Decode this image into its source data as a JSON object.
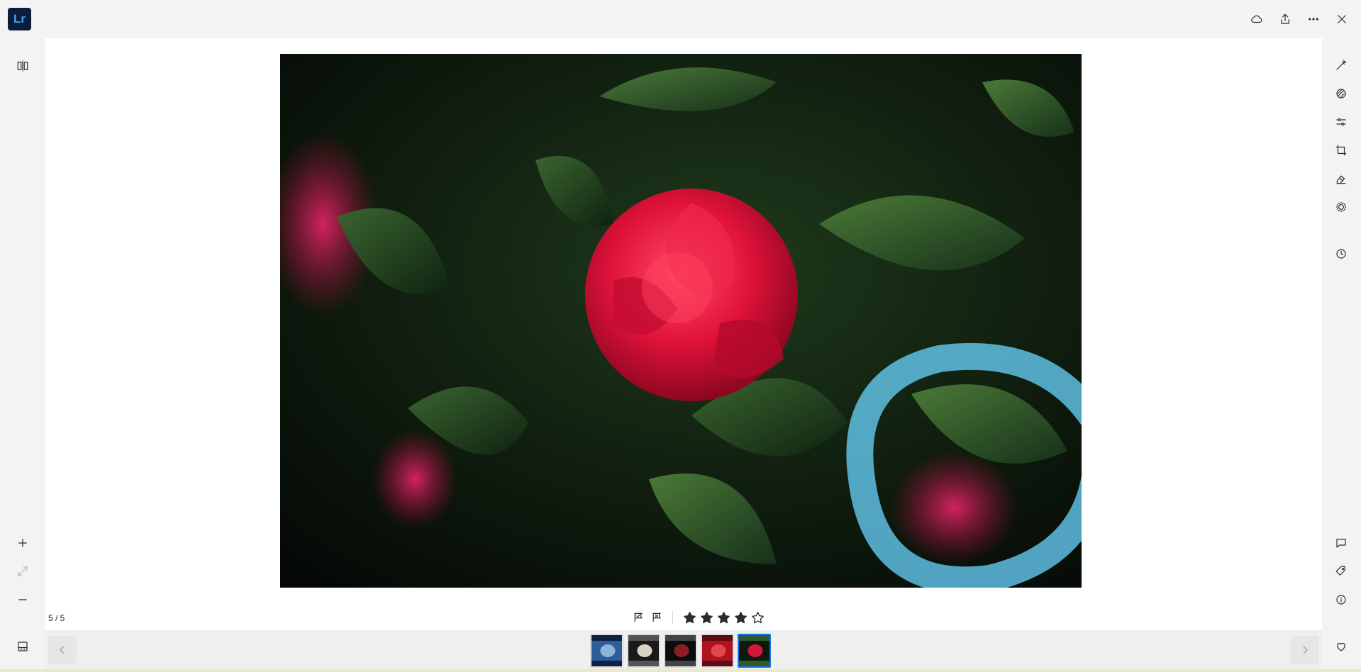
{
  "app": {
    "logo_text": "Lr",
    "accent": "#1473e6"
  },
  "topbar": {
    "actions": [
      {
        "name": "cloud-icon"
      },
      {
        "name": "share-icon"
      },
      {
        "name": "more-icon"
      },
      {
        "name": "close-icon"
      }
    ]
  },
  "left_rail": {
    "items": [
      "compare-view-icon",
      "zoom-in-icon",
      "fit-icon",
      "zoom-out-icon",
      "filmstrip-toggle-icon"
    ]
  },
  "right_rail": {
    "edit_tools": [
      "auto-edit-icon",
      "presets-icon",
      "edit-sliders-icon",
      "crop-icon",
      "healing-icon",
      "masking-icon",
      "versions-icon"
    ],
    "info_tools": [
      "comments-icon",
      "keywords-icon",
      "info-icon",
      "heart-icon"
    ]
  },
  "viewer": {
    "counter": "5 / 5",
    "rating": 4,
    "max_rating": 5,
    "flags": [
      "pick-flag-icon",
      "reject-flag-icon"
    ]
  },
  "filmstrip": {
    "thumbnails": [
      {
        "label": "city-night-thumb",
        "colors": [
          "#2d5d9a",
          "#8fb2d8",
          "#0f2140"
        ]
      },
      {
        "label": "car-interior-thumb",
        "colors": [
          "#1a1a1a",
          "#d9d4c2",
          "#555"
        ]
      },
      {
        "label": "guitar-thumb",
        "colors": [
          "#0c0c0c",
          "#8c1d24",
          "#444"
        ]
      },
      {
        "label": "red-car-thumb",
        "colors": [
          "#b1121d",
          "#e04552",
          "#5a0d12"
        ]
      },
      {
        "label": "camellia-thumb",
        "colors": [
          "#0e1a10",
          "#d11a3a",
          "#2f5a2a"
        ]
      }
    ],
    "active_index": 4
  }
}
